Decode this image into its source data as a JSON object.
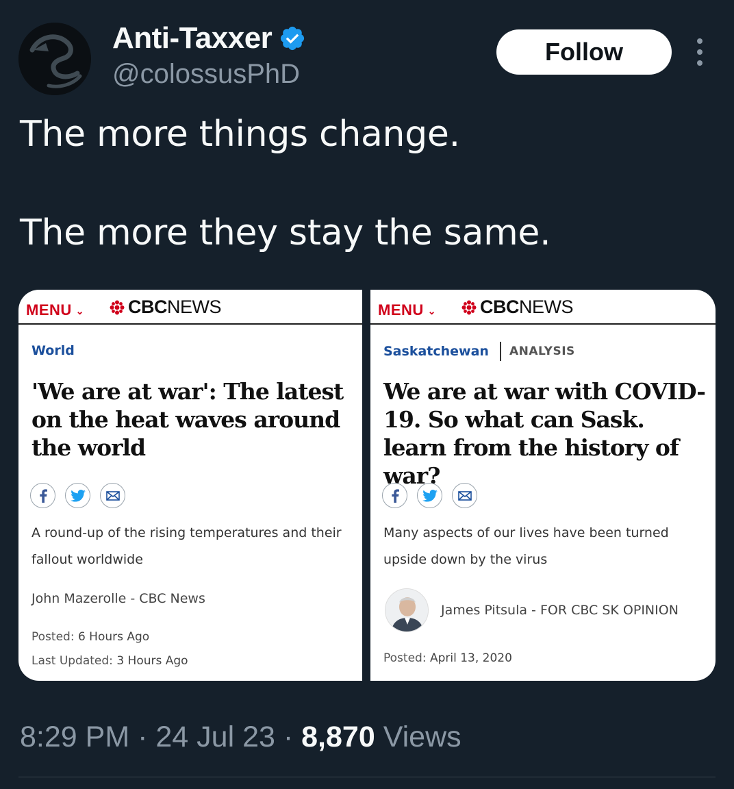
{
  "tweet": {
    "author_name": "Anti-Taxxer",
    "author_handle": "@colossusPhD",
    "follow_label": "Follow",
    "text_line_1": "The more things change.",
    "text_line_2": "The more they stay the same.",
    "time": "8:29 PM",
    "date": "24 Jul 23",
    "views_count": "8,870",
    "views_label": "Views",
    "separator": "·"
  },
  "cards": [
    {
      "menu_label": "MENU",
      "logo_bold": "CBC",
      "logo_light": "NEWS",
      "section": "World",
      "headline": "'We are at war': The latest on the heat waves around the world",
      "dek": "A round-up of the rising temperatures and their fallout worldwide",
      "byline": "John Mazerolle - CBC News",
      "posted_label": "Posted:",
      "posted_value": "6 Hours Ago",
      "updated_label": "Last Updated:",
      "updated_value": "3 Hours Ago"
    },
    {
      "menu_label": "MENU",
      "logo_bold": "CBC",
      "logo_light": "NEWS",
      "section": "Saskatchewan",
      "section_tag": "ANALYSIS",
      "headline": "We are at war with COVID-19. So what can Sask. learn from the history of war?",
      "dek": "Many aspects of our lives have been turned upside down by the virus",
      "byline": "James Pitsula - FOR CBC SK OPINION",
      "posted_label": "Posted:",
      "posted_value": "April 13, 2020"
    }
  ],
  "colors": {
    "background": "#15202b",
    "verified_blue": "#1d9bf0",
    "cbc_red": "#d0021b",
    "section_blue": "#1b4f9c"
  },
  "icons": [
    "verified-badge-icon",
    "more-options-icon",
    "cbc-gem-icon",
    "chevron-down-icon",
    "facebook-icon",
    "twitter-icon",
    "email-icon"
  ]
}
